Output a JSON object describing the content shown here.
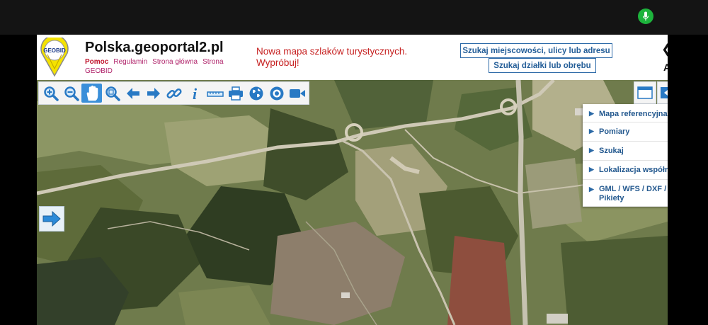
{
  "header": {
    "site_title": "Polska.geoportal2.pl",
    "logo_text": "GEOBID",
    "nav": [
      {
        "label": "Pomoc",
        "active": true
      },
      {
        "label": "Regulamin",
        "active": false
      },
      {
        "label": "Strona główna",
        "active": false
      },
      {
        "label": "Strona GEOBID",
        "active": false
      }
    ],
    "promo": "Nowa mapa szlaków turystycznych. Wypróbuj!",
    "search_place_label": "Szukaj miejscowości, ulicy lub adresu",
    "search_parcel_label": "Szukaj działki lub obrębu",
    "cut_letter": "A"
  },
  "toolbar": {
    "tools": [
      {
        "name": "zoom-in-tool",
        "icon": "zoom-in-icon"
      },
      {
        "name": "zoom-out-tool",
        "icon": "zoom-out-icon"
      },
      {
        "name": "pan-tool",
        "icon": "hand-icon",
        "active": true
      },
      {
        "name": "zoom-window-tool",
        "icon": "zoom-window-icon"
      },
      {
        "name": "previous-view-tool",
        "icon": "arrow-left-icon"
      },
      {
        "name": "next-view-tool",
        "icon": "arrow-right-icon"
      },
      {
        "name": "link-tool",
        "icon": "link-icon"
      },
      {
        "name": "info-tool",
        "icon": "info-icon",
        "glyph": "i"
      },
      {
        "name": "measure-tool",
        "icon": "ruler-icon"
      },
      {
        "name": "print-tool",
        "icon": "printer-icon"
      },
      {
        "name": "globe-tool",
        "icon": "globe-icon"
      },
      {
        "name": "location-tool",
        "icon": "target-icon"
      },
      {
        "name": "video-tool",
        "icon": "video-camera-icon"
      }
    ]
  },
  "side_panel": {
    "items": [
      {
        "label": "Mapa referencyjna"
      },
      {
        "label": "Pomiary"
      },
      {
        "label": "Szukaj"
      },
      {
        "label": "Lokalizacja współrzędnych"
      },
      {
        "label": "GML / WFS / DXF / Pikiety"
      }
    ]
  },
  "colors": {
    "accent": "#3a8fd9",
    "panel_text": "#24598f",
    "promo": "#c62020",
    "mic": "#1db33c"
  }
}
